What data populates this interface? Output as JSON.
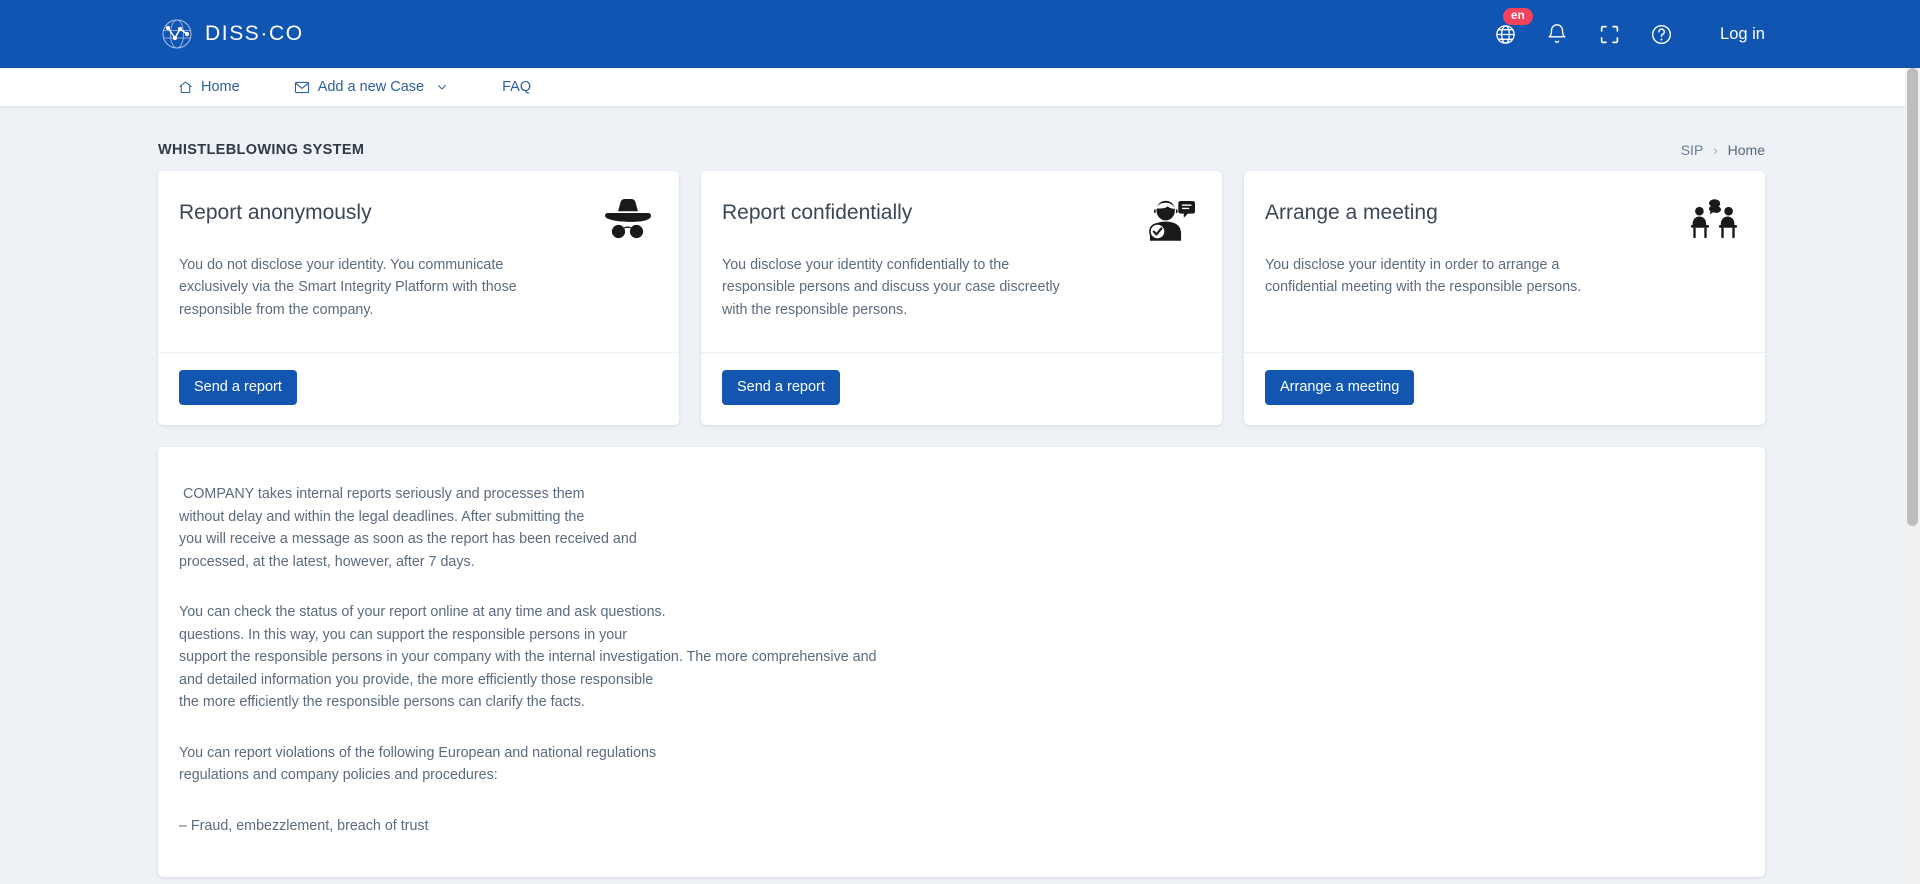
{
  "header": {
    "brand_name": "DISS·CO",
    "brand_icon": "network-globe-logo-icon",
    "language_badge": "en",
    "globe_icon": "globe-icon",
    "bell_icon": "bell-notification-icon",
    "fullscreen_icon": "fullscreen-expand-icon",
    "help_icon": "help-circle-icon",
    "login_label": "Log in"
  },
  "nav": {
    "items": [
      {
        "label": "Home",
        "icon": "home-icon",
        "has_chevron": false
      },
      {
        "label": "Add a new Case",
        "icon": "envelope-icon",
        "has_chevron": true
      },
      {
        "label": "FAQ",
        "icon": "",
        "has_chevron": false
      }
    ]
  },
  "page": {
    "title": "WHISTLEBLOWING SYSTEM",
    "breadcrumb": {
      "root": "SIP",
      "separator": "›",
      "current": "Home"
    }
  },
  "cards": [
    {
      "title": "Report anonymously",
      "description": "You do not disclose your identity. You communicate exclusively via the Smart Integrity Platform with those responsible from the company.",
      "button_label": "Send a report",
      "icon": "incognito-hat-glasses-icon"
    },
    {
      "title": "Report confidentially",
      "description": "You disclose your identity confidentially to the responsible persons and discuss your case discreetly with the responsible persons.",
      "button_label": "Send a report",
      "icon": "person-speech-bubble-verified-icon"
    },
    {
      "title": "Arrange a meeting",
      "description": "You disclose your identity in order to arrange a confidential meeting with the responsible persons.",
      "button_label": "Arrange a meeting",
      "icon": "two-people-meeting-icon"
    }
  ],
  "content": {
    "paragraph_1": " COMPANY takes internal reports seriously and processes them\nwithout delay and within the legal deadlines. After submitting the\nyou will receive a message as soon as the report has been received and\nprocessed, at the latest, however, after 7 days.",
    "paragraph_2": "You can check the status of your report online at any time and ask questions.\nquestions. In this way, you can support the responsible persons in your\nsupport the responsible persons in your company with the internal investigation. The more comprehensive and\nand detailed information you provide, the more efficiently those responsible\nthe more efficiently the responsible persons can clarify the facts.",
    "paragraph_3": "You can report violations of the following European and national regulations\nregulations and company policies and procedures:",
    "list_items": [
      "– Fraud, embezzlement, breach of trust"
    ]
  },
  "scrollbar": {
    "thumb_top": 0,
    "thumb_height": 458
  },
  "colors": {
    "brand_blue": "#1155b2",
    "button_blue": "#1256b0",
    "badge_red": "#f4415e",
    "page_background": "#eef2f6",
    "nav_link": "#2c5f9e"
  }
}
